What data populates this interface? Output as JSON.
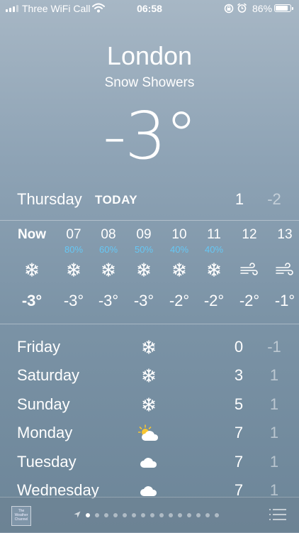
{
  "status_bar": {
    "carrier": "Three WiFi Call",
    "time": "06:58",
    "battery": "86%",
    "battery_level": 0.86,
    "icons": [
      "signal-icon",
      "wifi-icon",
      "rotation-lock-icon",
      "alarm-icon",
      "battery-icon"
    ]
  },
  "location": {
    "city": "London",
    "condition": "Snow Showers",
    "temperature": "-3°"
  },
  "today": {
    "day": "Thursday",
    "label": "TODAY",
    "high": "1",
    "low": "-2"
  },
  "hourly": [
    {
      "time": "Now",
      "precip": "",
      "icon": "snowflake-icon",
      "temp": "-3°"
    },
    {
      "time": "07",
      "precip": "80%",
      "icon": "snowflake-icon",
      "temp": "-3°"
    },
    {
      "time": "08",
      "precip": "60%",
      "icon": "snowflake-icon",
      "temp": "-3°"
    },
    {
      "time": "09",
      "precip": "50%",
      "icon": "snowflake-icon",
      "temp": "-3°"
    },
    {
      "time": "10",
      "precip": "40%",
      "icon": "snowflake-icon",
      "temp": "-2°"
    },
    {
      "time": "11",
      "precip": "40%",
      "icon": "snowflake-icon",
      "temp": "-2°"
    },
    {
      "time": "12",
      "precip": "",
      "icon": "wind-icon",
      "temp": "-2°"
    },
    {
      "time": "13",
      "precip": "",
      "icon": "wind-icon",
      "temp": "-1°"
    }
  ],
  "daily": [
    {
      "day": "Friday",
      "icon": "snowflake-icon",
      "high": "0",
      "low": "-1"
    },
    {
      "day": "Saturday",
      "icon": "snowflake-icon",
      "high": "3",
      "low": "1"
    },
    {
      "day": "Sunday",
      "icon": "snowflake-icon",
      "high": "5",
      "low": "1"
    },
    {
      "day": "Monday",
      "icon": "partly-sunny-icon",
      "high": "7",
      "low": "1"
    },
    {
      "day": "Tuesday",
      "icon": "cloud-icon",
      "high": "7",
      "low": "1"
    },
    {
      "day": "Wednesday",
      "icon": "cloud-icon",
      "high": "7",
      "low": "1"
    }
  ],
  "toolbar": {
    "logo_text": "The Weather Channel",
    "page_count": 15,
    "active_page": 0,
    "icons": [
      "location-arrow-icon",
      "list-icon"
    ]
  },
  "colors": {
    "precip_text": "#66c7f4",
    "sun": "#f7c531"
  }
}
